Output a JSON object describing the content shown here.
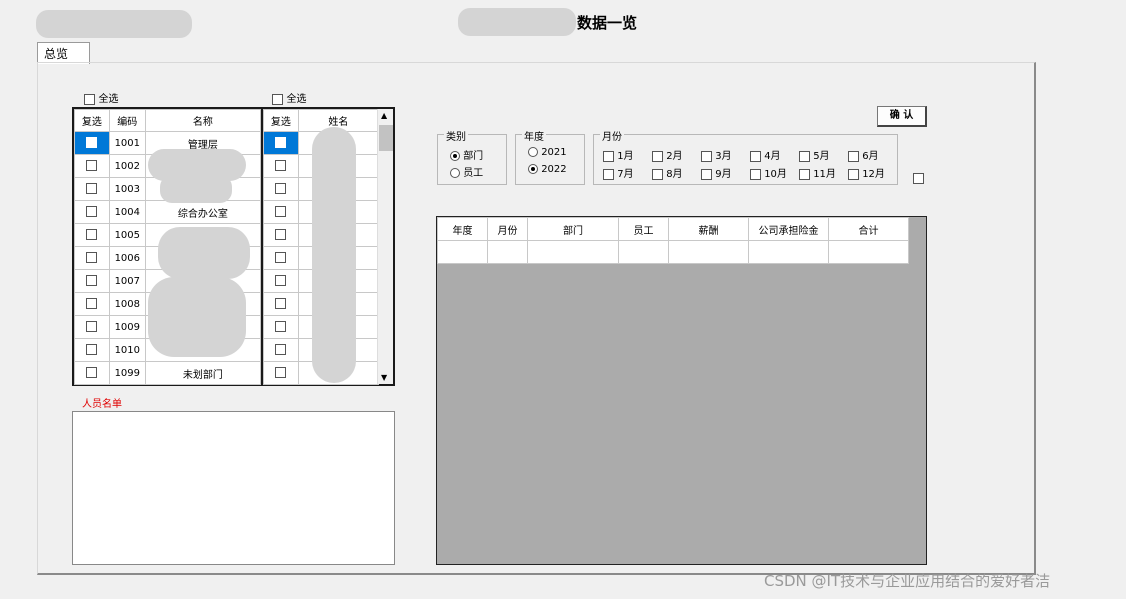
{
  "window": {
    "title": "数据一览"
  },
  "tabs": [
    {
      "label": "总览"
    }
  ],
  "dept_panel": {
    "select_all_label": "全选",
    "columns": [
      "复选",
      "编码",
      "名称"
    ],
    "rows": [
      {
        "code": "1001",
        "name": "管理层",
        "checked": false,
        "selected": true
      },
      {
        "code": "1002",
        "name": "",
        "checked": false,
        "selected": false
      },
      {
        "code": "1003",
        "name": "",
        "checked": false,
        "selected": false
      },
      {
        "code": "1004",
        "name": "综合办公室",
        "checked": false,
        "selected": false
      },
      {
        "code": "1005",
        "name": "",
        "checked": false,
        "selected": false
      },
      {
        "code": "1006",
        "name": "",
        "checked": false,
        "selected": false
      },
      {
        "code": "1007",
        "name": "",
        "checked": false,
        "selected": false
      },
      {
        "code": "1008",
        "name": "",
        "checked": false,
        "selected": false
      },
      {
        "code": "1009",
        "name": "",
        "checked": false,
        "selected": false
      },
      {
        "code": "1010",
        "name": "",
        "checked": false,
        "selected": false
      },
      {
        "code": "1099",
        "name": "未划部门",
        "checked": false,
        "selected": false
      }
    ]
  },
  "emp_panel": {
    "select_all_label": "全选",
    "columns": [
      "复选",
      "姓名"
    ],
    "row_count": 11
  },
  "staff_list": {
    "label": "人员名单"
  },
  "category_group": {
    "label": "类别",
    "options": [
      {
        "label": "部门",
        "selected": true
      },
      {
        "label": "员工",
        "selected": false
      }
    ]
  },
  "year_group": {
    "label": "年度",
    "options": [
      {
        "label": "2021",
        "selected": false
      },
      {
        "label": "2022",
        "selected": true
      }
    ]
  },
  "month_group": {
    "label": "月份",
    "months": [
      "1月",
      "2月",
      "3月",
      "4月",
      "5月",
      "6月",
      "7月",
      "8月",
      "9月",
      "10月",
      "11月",
      "12月"
    ]
  },
  "confirm_button": {
    "label": "确 认"
  },
  "data_grid": {
    "columns": [
      "年度",
      "月份",
      "部门",
      "员工",
      "薪酬",
      "公司承担险金",
      "合计"
    ]
  },
  "watermark": "CSDN @IT技术与企业应用结合的爱好者洁",
  "colors": {
    "selection": "#0078d7",
    "grid_bg": "#ababab",
    "red_label": "#e00000"
  },
  "icons": {
    "scroll_up": "triangle-up",
    "scroll_down": "triangle-down"
  }
}
